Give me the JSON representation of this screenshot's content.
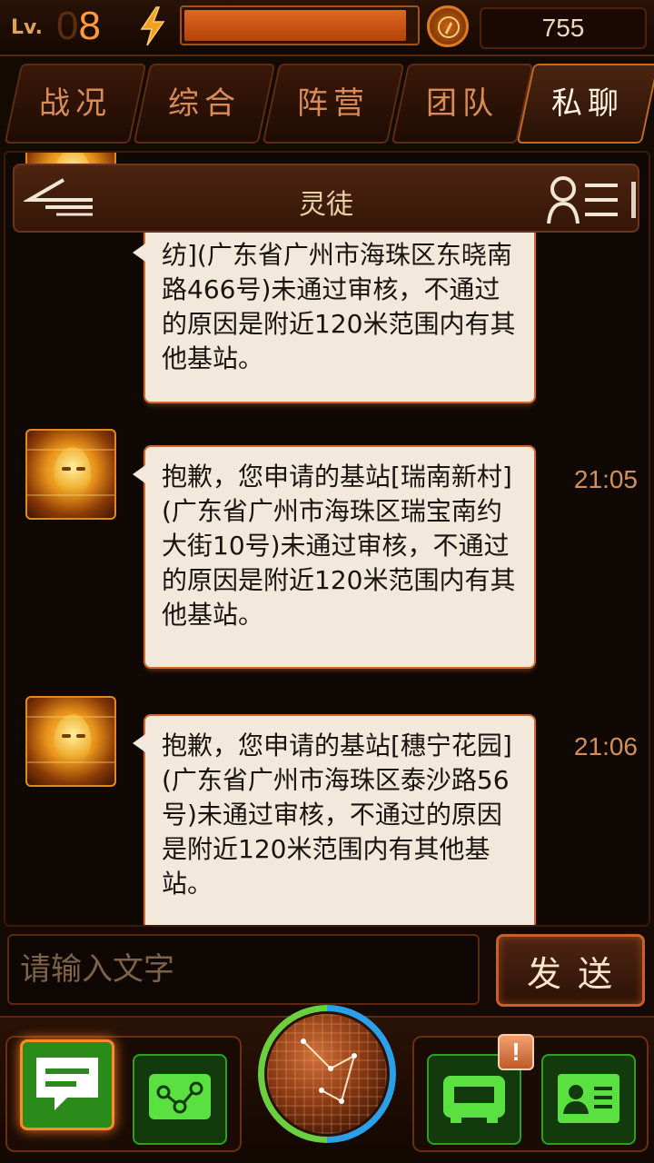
{
  "status": {
    "level_label": "Lv.",
    "level_value": "8",
    "level_value_dim": "0",
    "energy_fill_percent": 96,
    "coins": "755"
  },
  "tabs": [
    {
      "label": "战况",
      "active": false
    },
    {
      "label": "综合",
      "active": false
    },
    {
      "label": "阵营",
      "active": false
    },
    {
      "label": "团队",
      "active": false
    },
    {
      "label": "私聊",
      "active": true
    }
  ],
  "chat": {
    "title": "灵徒",
    "messages": [
      {
        "text": "纺](广东省广州市海珠区东晓南路466号)未通过审核，不通过的原因是附近120米范围内有其他基站。",
        "time": ""
      },
      {
        "text": "抱歉，您申请的基站[瑞南新村](广东省广州市海珠区瑞宝南约大街10号)未通过审核，不通过的原因是附近120米范围内有其他基站。",
        "time": "21:05"
      },
      {
        "text": "抱歉，您申请的基站[穗宁花园](广东省广州市海珠区泰沙路56号)未通过审核，不通过的原因是附近120米范围内有其他基站。",
        "time": "21:06"
      }
    ]
  },
  "composer": {
    "placeholder": "请输入文字",
    "send_label": "发送"
  },
  "nav": {
    "alert_badge": "!",
    "accent_colors": {
      "green": "#2ea01e",
      "orange": "#ff8a2a",
      "blue": "#2aa0e8"
    }
  }
}
